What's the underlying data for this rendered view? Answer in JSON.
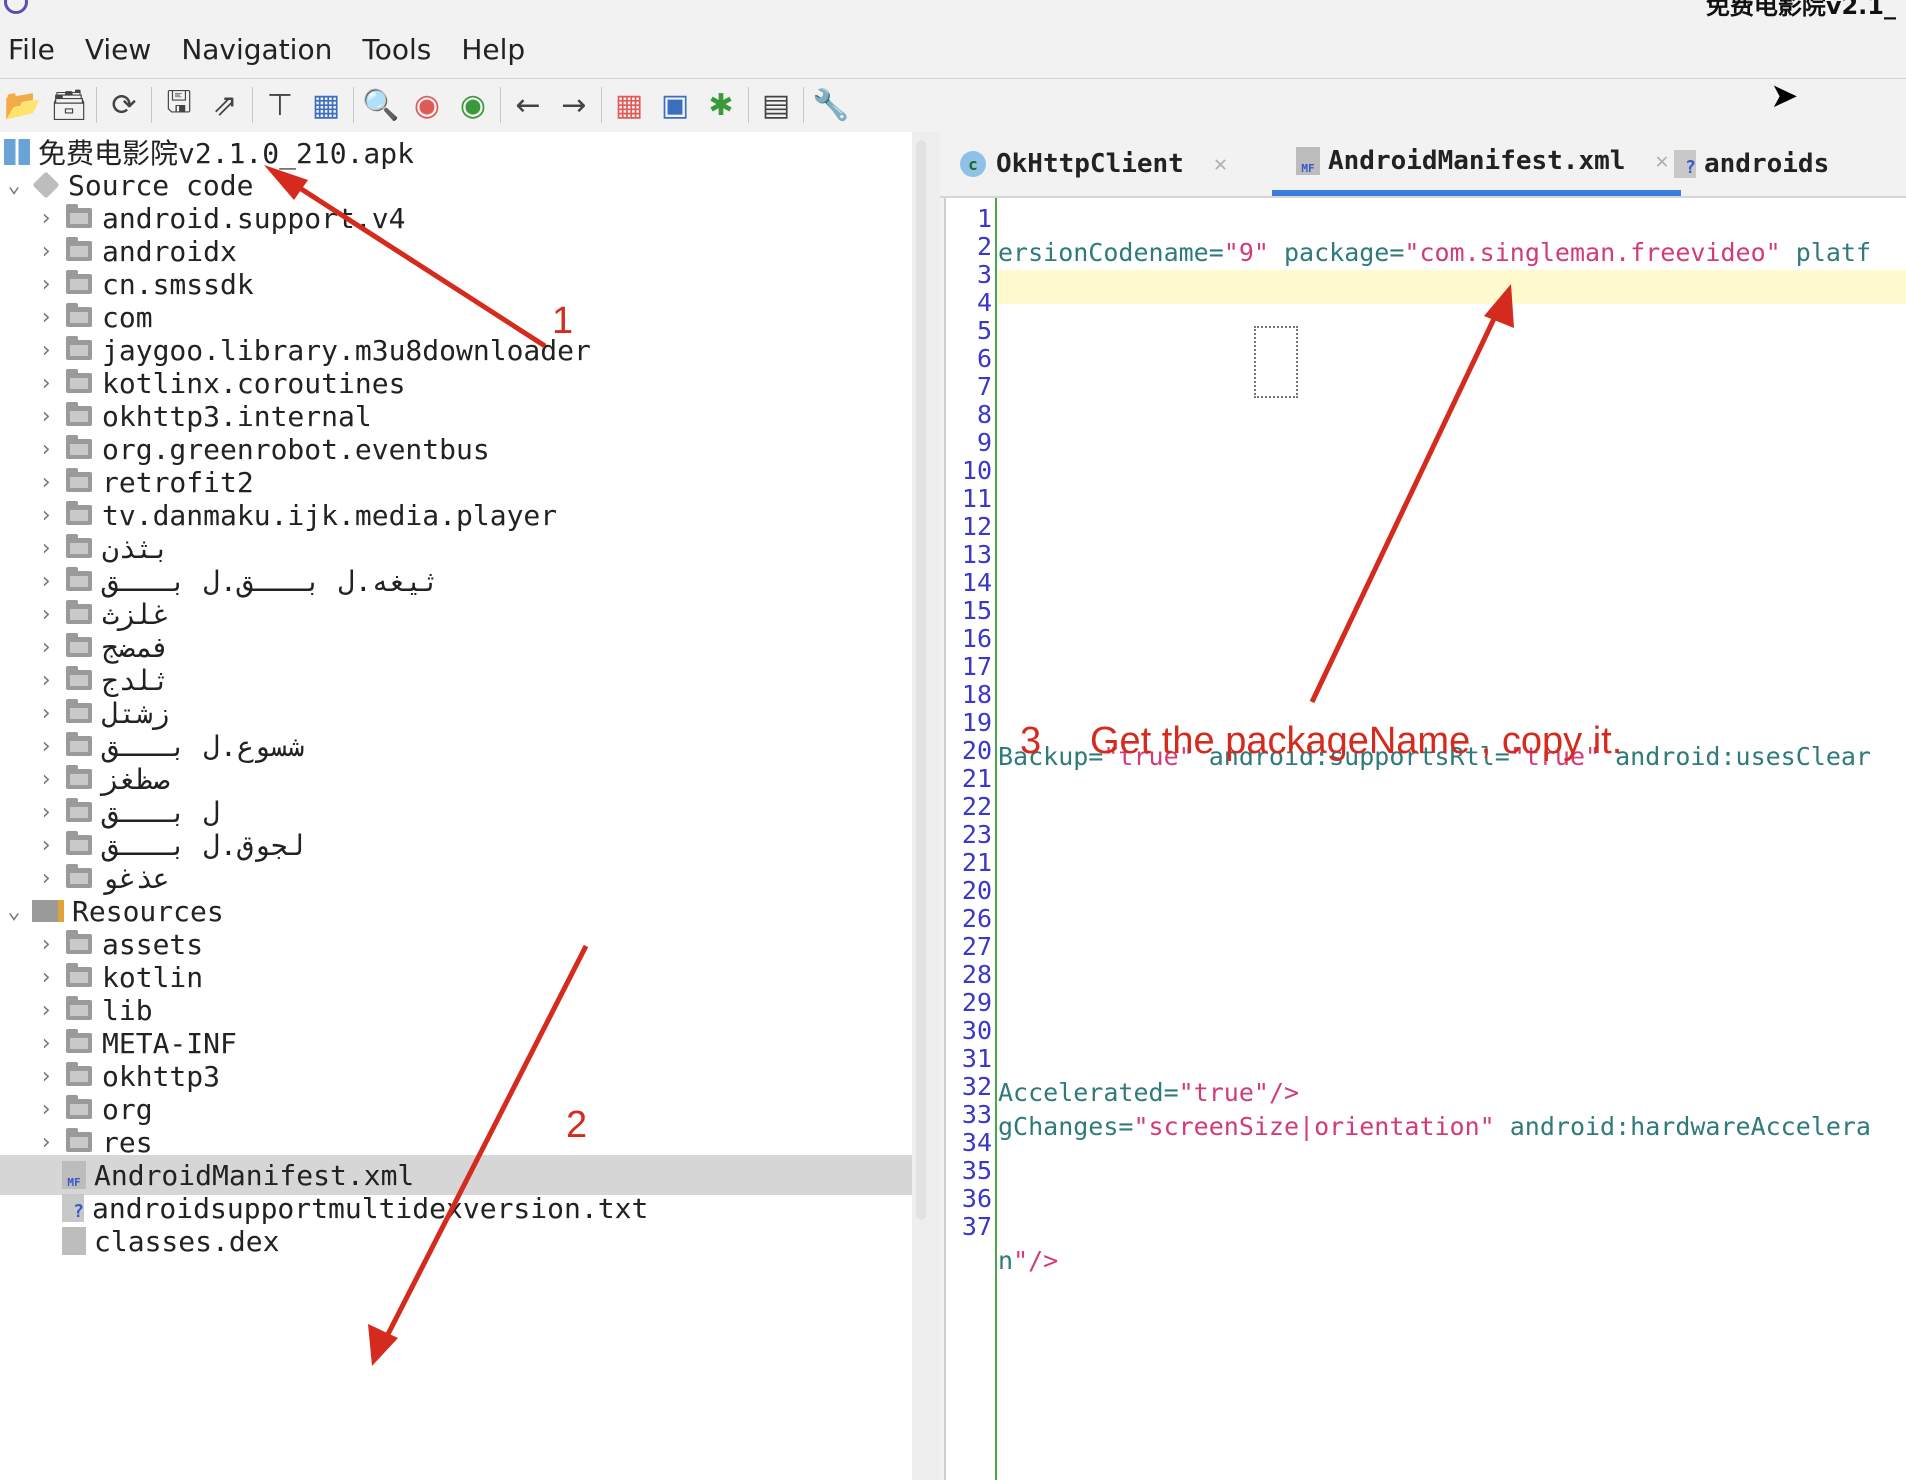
{
  "window": {
    "title_fragment": "免费电影院v2.1_"
  },
  "menu": [
    "File",
    "View",
    "Navigation",
    "Tools",
    "Help"
  ],
  "toolbar_icons": [
    "open-file-icon",
    "add-files-icon",
    "sync-icon",
    "save-icon",
    "export-icon",
    "flatten-icon",
    "tree-icon",
    "search-icon",
    "find-class-icon",
    "find-usage-icon",
    "back-icon",
    "forward-icon",
    "deobfuscation-icon",
    "quick-open-icon",
    "debug-icon",
    "log-icon",
    "preferences-icon"
  ],
  "tree": {
    "root": "免费电影院v2.1.0_210.apk",
    "source_label": "Source code",
    "source_packages": [
      "android.support.v4",
      "androidx",
      "cn.smssdk",
      "com",
      "jaygoo.library.m3u8downloader",
      "kotlinx.coroutines",
      "okhttp3.internal",
      "org.greenrobot.eventbus",
      "retrofit2",
      "tv.danmaku.ijk.media.player",
      "بثذن",
      "ثيغه.ل بـــق.ل بـــق",
      "غلزث",
      "فمضج",
      "ثلدج",
      "زشتل",
      "شسوع.ل بـــق",
      "صظغز",
      "ل بـــق",
      "لجوق.ل بـــق",
      "عذغو"
    ],
    "resources_label": "Resources",
    "resource_folders": [
      "assets",
      "kotlin",
      "lib",
      "META-INF",
      "okhttp3",
      "org",
      "res"
    ],
    "resource_files": [
      "AndroidManifest.xml",
      "androidsupportmultidexversion.txt",
      "classes.dex"
    ]
  },
  "tabs": [
    {
      "label": "OkHttpClient",
      "icon": "class-icon"
    },
    {
      "label": "AndroidManifest.xml",
      "icon": "manifest-icon",
      "active": true
    },
    {
      "label": "androids",
      "icon": "text-file-icon"
    }
  ],
  "editor": {
    "line_numbers": [
      "1",
      "2",
      "3",
      "4",
      "5",
      "6",
      "7",
      "8",
      "9",
      "10",
      "11",
      "12",
      "13",
      "14",
      "15",
      "16",
      "17",
      "18",
      "19",
      "20",
      "21",
      "22",
      "23",
      "21",
      "20",
      "26",
      "27",
      "28",
      "29",
      "30",
      "31",
      "32",
      "33",
      "34",
      "35",
      "36",
      "37"
    ],
    "line1": {
      "a": "ersionCodename=",
      "b": "\"9\"",
      "c": " package=",
      "d": "\"com.singleman.freevideo\"",
      "e": " platf"
    },
    "line19": {
      "a": "Backup=",
      "b": "\"true\"",
      "c": " android:supportsRtl=",
      "d": "\"true\"",
      "e": " android:usesClear"
    },
    "line31": {
      "a": "Accelerated=",
      "b": "\"true\"",
      "c": "/>"
    },
    "line32": {
      "a": "gChanges=",
      "b": "\"screenSize|orientation\"",
      "c": " android:hardwareAccelera"
    },
    "line36": {
      "a": "n",
      "b": "\"",
      "c": "/>"
    }
  },
  "annotations": {
    "a1": "1",
    "a2": "2",
    "a3_num": "3",
    "a3_text": "Get the packageName , copy it."
  },
  "colors": {
    "arrow": "#d52a1e",
    "active_tab": "#3b7dd8",
    "line_numbers": "#3a37c9",
    "attr": "#2f7a7a",
    "value": "#d13b7a"
  }
}
